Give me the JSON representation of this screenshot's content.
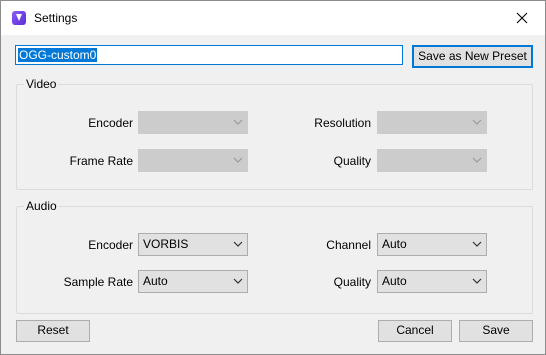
{
  "window": {
    "title": "Settings"
  },
  "preset": {
    "name_value": "OGG-custom0",
    "save_new_label": "Save as New Preset"
  },
  "video": {
    "group_label": "Video",
    "encoder_label": "Encoder",
    "encoder_value": "",
    "resolution_label": "Resolution",
    "resolution_value": "",
    "frame_rate_label": "Frame Rate",
    "frame_rate_value": "",
    "quality_label": "Quality",
    "quality_value": ""
  },
  "audio": {
    "group_label": "Audio",
    "encoder_label": "Encoder",
    "encoder_value": "VORBIS",
    "channel_label": "Channel",
    "channel_value": "Auto",
    "sample_rate_label": "Sample Rate",
    "sample_rate_value": "Auto",
    "quality_label": "Quality",
    "quality_value": "Auto"
  },
  "footer": {
    "reset_label": "Reset",
    "cancel_label": "Cancel",
    "save_label": "Save"
  },
  "colors": {
    "accent": "#0078d7",
    "dialog_bg": "#f0f0f0",
    "disabled_combo": "#cccccc"
  }
}
